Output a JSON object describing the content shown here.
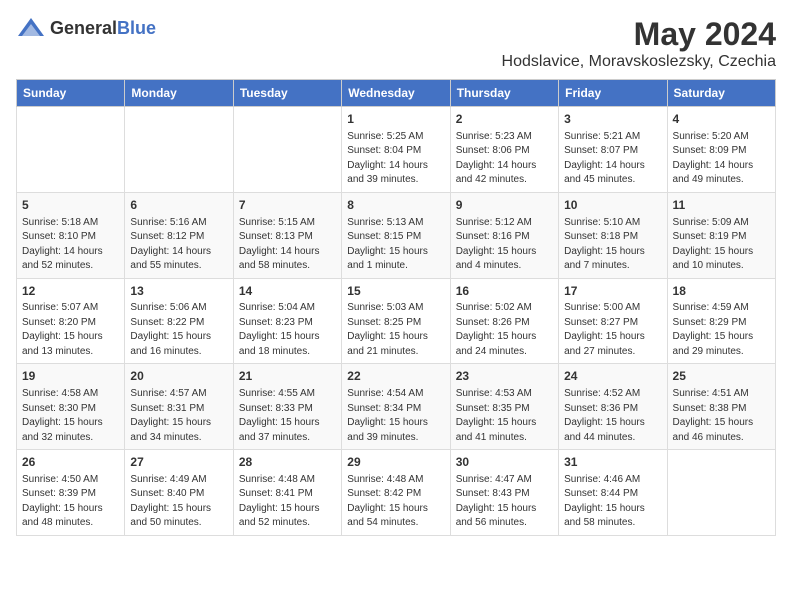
{
  "header": {
    "logo_general": "General",
    "logo_blue": "Blue",
    "title": "May 2024",
    "subtitle": "Hodslavice, Moravskoslezsky, Czechia"
  },
  "columns": [
    "Sunday",
    "Monday",
    "Tuesday",
    "Wednesday",
    "Thursday",
    "Friday",
    "Saturday"
  ],
  "weeks": [
    [
      {
        "day": "",
        "info": ""
      },
      {
        "day": "",
        "info": ""
      },
      {
        "day": "",
        "info": ""
      },
      {
        "day": "1",
        "info": "Sunrise: 5:25 AM\nSunset: 8:04 PM\nDaylight: 14 hours\nand 39 minutes."
      },
      {
        "day": "2",
        "info": "Sunrise: 5:23 AM\nSunset: 8:06 PM\nDaylight: 14 hours\nand 42 minutes."
      },
      {
        "day": "3",
        "info": "Sunrise: 5:21 AM\nSunset: 8:07 PM\nDaylight: 14 hours\nand 45 minutes."
      },
      {
        "day": "4",
        "info": "Sunrise: 5:20 AM\nSunset: 8:09 PM\nDaylight: 14 hours\nand 49 minutes."
      }
    ],
    [
      {
        "day": "5",
        "info": "Sunrise: 5:18 AM\nSunset: 8:10 PM\nDaylight: 14 hours\nand 52 minutes."
      },
      {
        "day": "6",
        "info": "Sunrise: 5:16 AM\nSunset: 8:12 PM\nDaylight: 14 hours\nand 55 minutes."
      },
      {
        "day": "7",
        "info": "Sunrise: 5:15 AM\nSunset: 8:13 PM\nDaylight: 14 hours\nand 58 minutes."
      },
      {
        "day": "8",
        "info": "Sunrise: 5:13 AM\nSunset: 8:15 PM\nDaylight: 15 hours\nand 1 minute."
      },
      {
        "day": "9",
        "info": "Sunrise: 5:12 AM\nSunset: 8:16 PM\nDaylight: 15 hours\nand 4 minutes."
      },
      {
        "day": "10",
        "info": "Sunrise: 5:10 AM\nSunset: 8:18 PM\nDaylight: 15 hours\nand 7 minutes."
      },
      {
        "day": "11",
        "info": "Sunrise: 5:09 AM\nSunset: 8:19 PM\nDaylight: 15 hours\nand 10 minutes."
      }
    ],
    [
      {
        "day": "12",
        "info": "Sunrise: 5:07 AM\nSunset: 8:20 PM\nDaylight: 15 hours\nand 13 minutes."
      },
      {
        "day": "13",
        "info": "Sunrise: 5:06 AM\nSunset: 8:22 PM\nDaylight: 15 hours\nand 16 minutes."
      },
      {
        "day": "14",
        "info": "Sunrise: 5:04 AM\nSunset: 8:23 PM\nDaylight: 15 hours\nand 18 minutes."
      },
      {
        "day": "15",
        "info": "Sunrise: 5:03 AM\nSunset: 8:25 PM\nDaylight: 15 hours\nand 21 minutes."
      },
      {
        "day": "16",
        "info": "Sunrise: 5:02 AM\nSunset: 8:26 PM\nDaylight: 15 hours\nand 24 minutes."
      },
      {
        "day": "17",
        "info": "Sunrise: 5:00 AM\nSunset: 8:27 PM\nDaylight: 15 hours\nand 27 minutes."
      },
      {
        "day": "18",
        "info": "Sunrise: 4:59 AM\nSunset: 8:29 PM\nDaylight: 15 hours\nand 29 minutes."
      }
    ],
    [
      {
        "day": "19",
        "info": "Sunrise: 4:58 AM\nSunset: 8:30 PM\nDaylight: 15 hours\nand 32 minutes."
      },
      {
        "day": "20",
        "info": "Sunrise: 4:57 AM\nSunset: 8:31 PM\nDaylight: 15 hours\nand 34 minutes."
      },
      {
        "day": "21",
        "info": "Sunrise: 4:55 AM\nSunset: 8:33 PM\nDaylight: 15 hours\nand 37 minutes."
      },
      {
        "day": "22",
        "info": "Sunrise: 4:54 AM\nSunset: 8:34 PM\nDaylight: 15 hours\nand 39 minutes."
      },
      {
        "day": "23",
        "info": "Sunrise: 4:53 AM\nSunset: 8:35 PM\nDaylight: 15 hours\nand 41 minutes."
      },
      {
        "day": "24",
        "info": "Sunrise: 4:52 AM\nSunset: 8:36 PM\nDaylight: 15 hours\nand 44 minutes."
      },
      {
        "day": "25",
        "info": "Sunrise: 4:51 AM\nSunset: 8:38 PM\nDaylight: 15 hours\nand 46 minutes."
      }
    ],
    [
      {
        "day": "26",
        "info": "Sunrise: 4:50 AM\nSunset: 8:39 PM\nDaylight: 15 hours\nand 48 minutes."
      },
      {
        "day": "27",
        "info": "Sunrise: 4:49 AM\nSunset: 8:40 PM\nDaylight: 15 hours\nand 50 minutes."
      },
      {
        "day": "28",
        "info": "Sunrise: 4:48 AM\nSunset: 8:41 PM\nDaylight: 15 hours\nand 52 minutes."
      },
      {
        "day": "29",
        "info": "Sunrise: 4:48 AM\nSunset: 8:42 PM\nDaylight: 15 hours\nand 54 minutes."
      },
      {
        "day": "30",
        "info": "Sunrise: 4:47 AM\nSunset: 8:43 PM\nDaylight: 15 hours\nand 56 minutes."
      },
      {
        "day": "31",
        "info": "Sunrise: 4:46 AM\nSunset: 8:44 PM\nDaylight: 15 hours\nand 58 minutes."
      },
      {
        "day": "",
        "info": ""
      }
    ]
  ]
}
